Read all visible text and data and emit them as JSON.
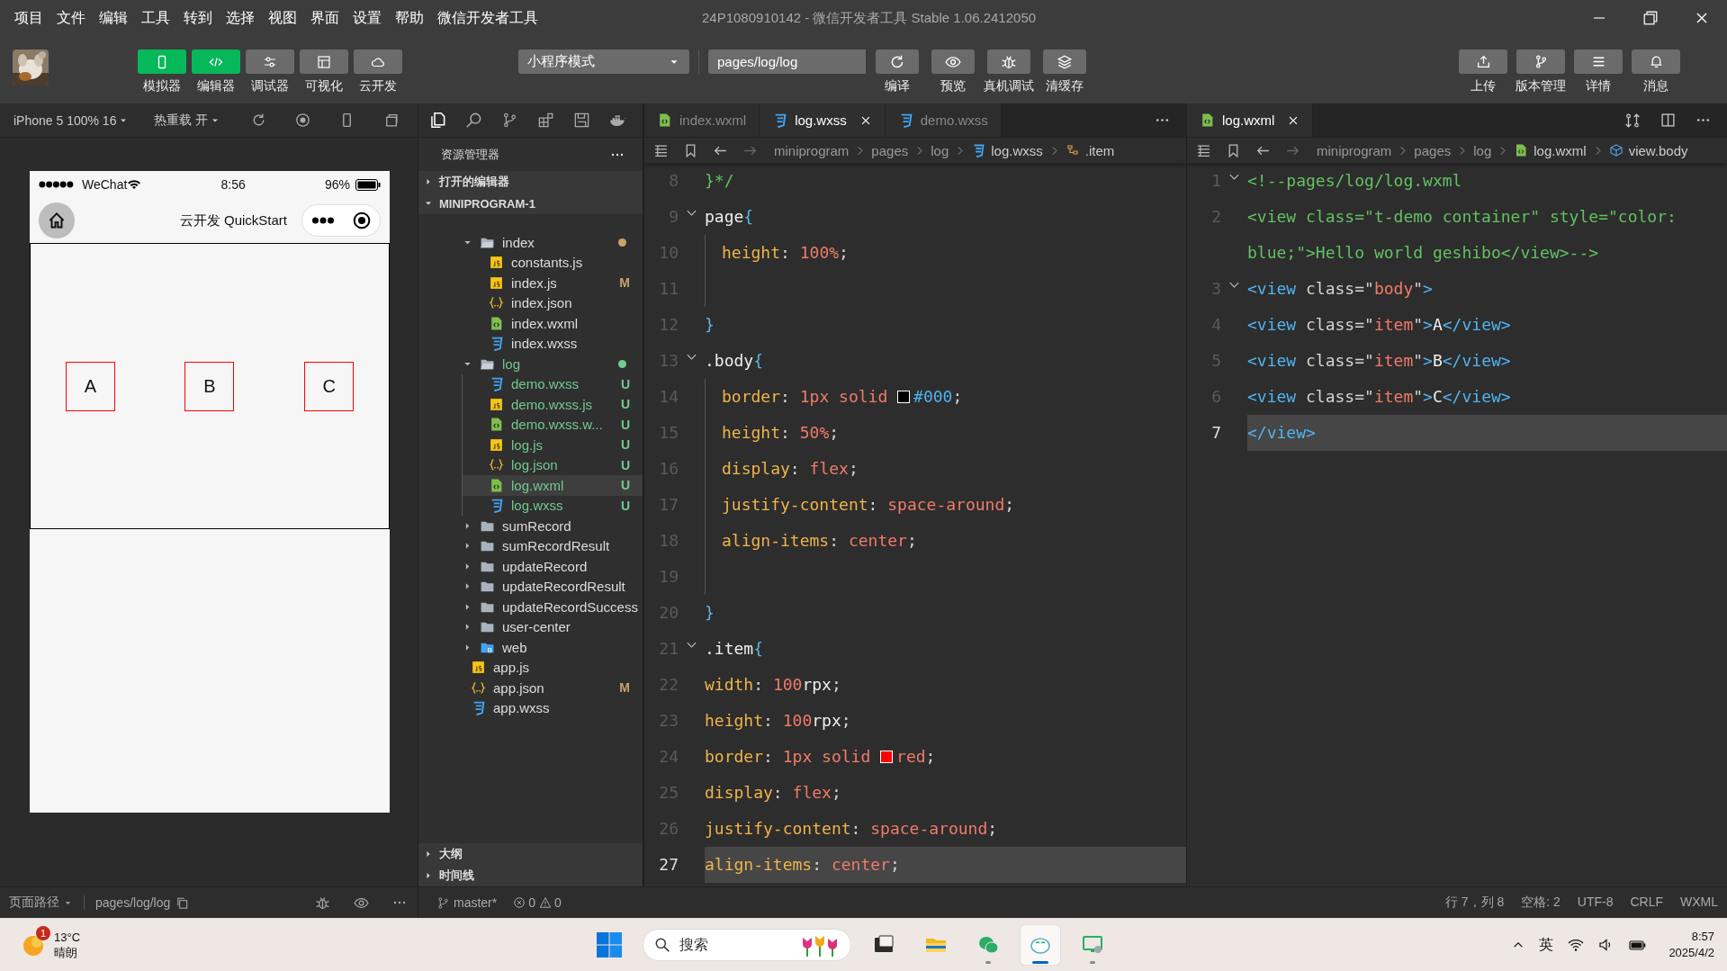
{
  "menu": [
    "项目",
    "文件",
    "编辑",
    "工具",
    "转到",
    "选择",
    "视图",
    "界面",
    "设置",
    "帮助",
    "微信开发者工具"
  ],
  "window": {
    "title": "24P1080910142 - 微信开发者工具 Stable 1.06.2412050"
  },
  "toolbar": {
    "modes": [
      {
        "label": "模拟器",
        "on": true
      },
      {
        "label": "编辑器",
        "on": true
      },
      {
        "label": "调试器",
        "on": false
      },
      {
        "label": "可视化",
        "on": false
      },
      {
        "label": "云开发",
        "on": false
      }
    ],
    "compile_mode": "小程序模式",
    "page_path": "pages/log/log",
    "actions": [
      "编译",
      "预览",
      "真机调试",
      "清缓存"
    ],
    "right_actions": [
      "上传",
      "版本管理",
      "详情",
      "消息"
    ]
  },
  "simulator": {
    "device": "iPhone 5 100% 16",
    "hot_reload": "热重载 开",
    "carrier": "WeChat",
    "time": "8:56",
    "battery": "96%",
    "title": "云开发 QuickStart",
    "items": [
      "A",
      "B",
      "C"
    ],
    "path_label": "页面路径",
    "path": "pages/log/log"
  },
  "explorer": {
    "title": "资源管理器",
    "sections": [
      {
        "label": "打开的编辑器",
        "expanded": false
      },
      {
        "label": "MINIPROGRAM-1",
        "expanded": true
      }
    ],
    "tree": [
      {
        "name": "index",
        "kind": "folder",
        "expanded": true,
        "color": "#c9a26d",
        "selected": false,
        "children": [
          {
            "name": "constants.js",
            "kind": "js",
            "selected": false
          },
          {
            "name": "index.js",
            "kind": "js",
            "badge": "M",
            "selected": false
          },
          {
            "name": "index.json",
            "kind": "json",
            "selected": false
          },
          {
            "name": "index.wxml",
            "kind": "wxml",
            "selected": false
          },
          {
            "name": "index.wxss",
            "kind": "wxss",
            "selected": false
          }
        ]
      },
      {
        "name": "log",
        "kind": "folder",
        "expanded": true,
        "color": "#73c991",
        "untracked": true,
        "selected": false,
        "children": [
          {
            "name": "demo.wxss",
            "kind": "wxss",
            "badge": "U",
            "untracked": true,
            "selected": false
          },
          {
            "name": "demo.wxss.js",
            "kind": "js",
            "badge": "U",
            "untracked": true,
            "selected": false
          },
          {
            "name": "demo.wxss.w...",
            "kind": "wxml",
            "badge": "U",
            "untracked": true,
            "selected": false
          },
          {
            "name": "log.js",
            "kind": "js",
            "badge": "U",
            "untracked": true,
            "selected": false
          },
          {
            "name": "log.json",
            "kind": "json",
            "badge": "U",
            "untracked": true,
            "selected": false
          },
          {
            "name": "log.wxml",
            "kind": "wxml",
            "badge": "U",
            "untracked": true,
            "selected": true
          },
          {
            "name": "log.wxss",
            "kind": "wxss",
            "badge": "U",
            "untracked": true,
            "selected": false
          }
        ]
      },
      {
        "name": "sumRecord",
        "kind": "folder",
        "expanded": false,
        "selected": false
      },
      {
        "name": "sumRecordResult",
        "kind": "folder",
        "expanded": false,
        "selected": false
      },
      {
        "name": "updateRecord",
        "kind": "folder",
        "expanded": false,
        "selected": false
      },
      {
        "name": "updateRecordResult",
        "kind": "folder",
        "expanded": false,
        "selected": false
      },
      {
        "name": "updateRecordSuccess",
        "kind": "folder",
        "expanded": false,
        "selected": false
      },
      {
        "name": "user-center",
        "kind": "folder",
        "expanded": false,
        "selected": false
      },
      {
        "name": "web",
        "kind": "web",
        "expanded": false,
        "selected": false
      },
      {
        "name": "app.js",
        "kind": "js",
        "selected": false
      },
      {
        "name": "app.json",
        "kind": "json",
        "badge": "M",
        "selected": false
      },
      {
        "name": "app.wxss",
        "kind": "wxss",
        "selected": false
      }
    ],
    "bottom_sections": [
      {
        "label": "大纲",
        "expanded": false
      },
      {
        "label": "时间线",
        "expanded": false
      }
    ]
  },
  "editors": [
    {
      "tabs": [
        {
          "label": "index.wxml",
          "kind": "wxml",
          "selected": false
        },
        {
          "label": "log.wxss",
          "kind": "wxss",
          "selected": true
        },
        {
          "label": "demo.wxss",
          "kind": "wxss",
          "selected": false
        }
      ],
      "breadcrumb": [
        {
          "label": "miniprogram"
        },
        {
          "label": "pages"
        },
        {
          "label": "log"
        },
        {
          "label": "log.wxss",
          "kind": "wxss"
        },
        {
          "label": ".item",
          "kind": "selector"
        }
      ],
      "lines": [
        {
          "number": "8",
          "tokens": [
            {
              "kind": "comment",
              "text": "}*/"
            }
          ]
        },
        {
          "number": "9",
          "fold": true,
          "tokens": [
            {
              "kind": "sel",
              "text": "page"
            },
            {
              "kind": "brace",
              "text": "{"
            }
          ]
        },
        {
          "number": "10",
          "indented": true,
          "tokens": [
            {
              "kind": "prop",
              "text": "height"
            },
            {
              "kind": "punct",
              "text": ": "
            },
            {
              "kind": "val",
              "text": "100%"
            },
            {
              "kind": "punct",
              "text": ";"
            }
          ]
        },
        {
          "number": "11",
          "indented": true
        },
        {
          "number": "12",
          "tokens": [
            {
              "kind": "brace",
              "text": "}"
            }
          ]
        },
        {
          "number": "13",
          "fold": true,
          "tokens": [
            {
              "kind": "sel",
              "text": ".body"
            },
            {
              "kind": "brace",
              "text": "{"
            }
          ]
        },
        {
          "number": "14",
          "indented": true,
          "tokens": [
            {
              "kind": "prop",
              "text": "border"
            },
            {
              "kind": "punct",
              "text": ": "
            },
            {
              "kind": "val",
              "text": "1px solid "
            },
            {
              "kind": "swatch",
              "color": "#000000"
            },
            {
              "kind": "hex",
              "text": "#000"
            },
            {
              "kind": "punct",
              "text": ";"
            }
          ]
        },
        {
          "number": "15",
          "indented": true,
          "tokens": [
            {
              "kind": "prop",
              "text": "height"
            },
            {
              "kind": "punct",
              "text": ": "
            },
            {
              "kind": "val",
              "text": "50%"
            },
            {
              "kind": "punct",
              "text": ";"
            }
          ]
        },
        {
          "number": "16",
          "indented": true,
          "tokens": [
            {
              "kind": "prop",
              "text": "display"
            },
            {
              "kind": "punct",
              "text": ": "
            },
            {
              "kind": "val",
              "text": "flex"
            },
            {
              "kind": "punct",
              "text": ";"
            }
          ]
        },
        {
          "number": "17",
          "indented": true,
          "tokens": [
            {
              "kind": "prop",
              "text": "justify-content"
            },
            {
              "kind": "punct",
              "text": ": "
            },
            {
              "kind": "val",
              "text": "space-around"
            },
            {
              "kind": "punct",
              "text": ";"
            }
          ]
        },
        {
          "number": "18",
          "indented": true,
          "tokens": [
            {
              "kind": "prop",
              "text": "align-items"
            },
            {
              "kind": "punct",
              "text": ": "
            },
            {
              "kind": "val",
              "text": "center"
            },
            {
              "kind": "punct",
              "text": ";"
            }
          ]
        },
        {
          "number": "19",
          "indented": true
        },
        {
          "number": "20",
          "tokens": [
            {
              "kind": "brace",
              "text": "}"
            }
          ]
        },
        {
          "number": "21",
          "fold": true,
          "tokens": [
            {
              "kind": "sel",
              "text": ".item"
            },
            {
              "kind": "brace",
              "text": "{"
            }
          ]
        },
        {
          "number": "22",
          "tokens": [
            {
              "kind": "prop",
              "text": "width"
            },
            {
              "kind": "punct",
              "text": ": "
            },
            {
              "kind": "val",
              "text": "100"
            },
            {
              "kind": "unit",
              "text": "rpx"
            },
            {
              "kind": "punct",
              "text": ";"
            }
          ]
        },
        {
          "number": "23",
          "tokens": [
            {
              "kind": "prop",
              "text": "height"
            },
            {
              "kind": "punct",
              "text": ": "
            },
            {
              "kind": "val",
              "text": "100"
            },
            {
              "kind": "unit",
              "text": "rpx"
            },
            {
              "kind": "punct",
              "text": ";"
            }
          ]
        },
        {
          "number": "24",
          "tokens": [
            {
              "kind": "prop",
              "text": "border"
            },
            {
              "kind": "punct",
              "text": ": "
            },
            {
              "kind": "val",
              "text": "1px solid "
            },
            {
              "kind": "swatch",
              "color": "#ff0000"
            },
            {
              "kind": "val",
              "text": "red"
            },
            {
              "kind": "punct",
              "text": ";"
            }
          ]
        },
        {
          "number": "25",
          "tokens": [
            {
              "kind": "prop",
              "text": "display"
            },
            {
              "kind": "punct",
              "text": ": "
            },
            {
              "kind": "val",
              "text": "flex"
            },
            {
              "kind": "punct",
              "text": ";"
            }
          ]
        },
        {
          "number": "26",
          "tokens": [
            {
              "kind": "prop",
              "text": "justify-content"
            },
            {
              "kind": "punct",
              "text": ": "
            },
            {
              "kind": "val",
              "text": "space-around"
            },
            {
              "kind": "punct",
              "text": ";"
            }
          ]
        },
        {
          "number": "27",
          "current": true,
          "tokens": [
            {
              "kind": "prop",
              "text": "align-items"
            },
            {
              "kind": "punct",
              "text": ": "
            },
            {
              "kind": "val",
              "text": "center"
            },
            {
              "kind": "punct",
              "text": ";"
            }
          ]
        }
      ]
    },
    {
      "tabs": [
        {
          "label": "log.wxml",
          "kind": "wxml",
          "selected": true
        }
      ],
      "breadcrumb": [
        {
          "label": "miniprogram"
        },
        {
          "label": "pages"
        },
        {
          "label": "log"
        },
        {
          "label": "log.wxml",
          "kind": "wxml"
        },
        {
          "label": "view.body",
          "kind": "cube"
        }
      ],
      "lines": [
        {
          "number": "1",
          "fold": true,
          "tokens": [
            {
              "kind": "comment",
              "text": "<!--pages/log/log.wxml"
            }
          ]
        },
        {
          "number": "2",
          "tokens": [
            {
              "kind": "comment",
              "text": "<view class=\"t-demo container\" style=\"color: blue;\">Hello world geshibo</view>-->"
            }
          ]
        },
        {
          "number": "3",
          "fold": true,
          "tokens": [
            {
              "kind": "tag",
              "text": "<view"
            },
            {
              "kind": "attr",
              "text": " class="
            },
            {
              "kind": "punct",
              "text": "\""
            },
            {
              "kind": "str",
              "text": "body"
            },
            {
              "kind": "punct",
              "text": "\""
            },
            {
              "kind": "tag",
              "text": ">"
            }
          ]
        },
        {
          "number": "4",
          "tokens": [
            {
              "kind": "tag",
              "text": "<view"
            },
            {
              "kind": "attr",
              "text": " class="
            },
            {
              "kind": "punct",
              "text": "\""
            },
            {
              "kind": "str",
              "text": "item"
            },
            {
              "kind": "punct",
              "text": "\""
            },
            {
              "kind": "tag",
              "text": ">"
            },
            {
              "kind": "text",
              "text": "A"
            },
            {
              "kind": "tag",
              "text": "</view>"
            }
          ]
        },
        {
          "number": "5",
          "tokens": [
            {
              "kind": "tag",
              "text": "<view"
            },
            {
              "kind": "attr",
              "text": " class="
            },
            {
              "kind": "punct",
              "text": "\""
            },
            {
              "kind": "str",
              "text": "item"
            },
            {
              "kind": "punct",
              "text": "\""
            },
            {
              "kind": "tag",
              "text": ">"
            },
            {
              "kind": "text",
              "text": "B"
            },
            {
              "kind": "tag",
              "text": "</view>"
            }
          ]
        },
        {
          "number": "6",
          "tokens": [
            {
              "kind": "tag",
              "text": "<view"
            },
            {
              "kind": "attr",
              "text": " class="
            },
            {
              "kind": "punct",
              "text": "\""
            },
            {
              "kind": "str",
              "text": "item"
            },
            {
              "kind": "punct",
              "text": "\""
            },
            {
              "kind": "tag",
              "text": ">"
            },
            {
              "kind": "text",
              "text": "C"
            },
            {
              "kind": "tag",
              "text": "</view>"
            }
          ]
        },
        {
          "number": "7",
          "current": true,
          "tokens": [
            {
              "kind": "tag",
              "text": "</view>"
            }
          ]
        }
      ]
    }
  ],
  "status_bar": {
    "branch": "master*",
    "errors": "0",
    "warnings": "0",
    "position": "行 7，列 8",
    "spaces": "空格: 2",
    "encoding": "UTF-8",
    "eol": "CRLF",
    "language": "WXML"
  },
  "taskbar": {
    "weather": {
      "badge": "1",
      "temp": "13°C",
      "desc": "晴朗"
    },
    "search_placeholder": "搜索",
    "apps": [
      {
        "running": false,
        "selected": false
      },
      {
        "running": false,
        "selected": false
      },
      {
        "running": true,
        "selected": false
      },
      {
        "running": true,
        "selected": true
      },
      {
        "running": true,
        "selected": false
      }
    ],
    "ime": "英",
    "time": "8:57",
    "date": "2025/4/2"
  }
}
